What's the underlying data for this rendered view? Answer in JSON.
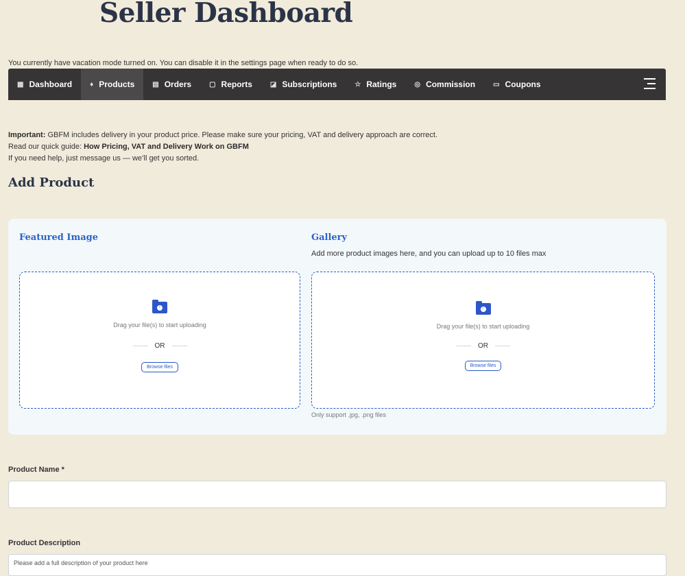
{
  "page_title": "Seller Dashboard",
  "vacation_notice": "You currently have vacation mode turned on. You can disable it in the settings page when ready to do so.",
  "nav": {
    "items": [
      {
        "label": "Dashboard",
        "icon": "grid-icon"
      },
      {
        "label": "Products",
        "icon": "shirt-icon",
        "active": true
      },
      {
        "label": "Orders",
        "icon": "cart-icon"
      },
      {
        "label": "Reports",
        "icon": "report-icon"
      },
      {
        "label": "Subscriptions",
        "icon": "tag-icon"
      },
      {
        "label": "Ratings",
        "icon": "star-icon"
      },
      {
        "label": "Commission",
        "icon": "coins-icon"
      },
      {
        "label": "Coupons",
        "icon": "coupon-icon"
      }
    ],
    "menu_icon": "hamburger-icon"
  },
  "notice": {
    "important_label": "Important:",
    "important_text": " GBFM includes delivery in your product price. Please make sure your pricing, VAT and delivery approach are correct.",
    "guide_prefix": "Read our quick guide: ",
    "guide_link": "How Pricing, VAT and Delivery Work on GBFM",
    "help_text": "If you need help, just message us — we’ll get you sorted."
  },
  "section_title": "Add Product",
  "featured_image": {
    "title": "Featured Image",
    "drag_text": "Drag your file(s) to start uploading",
    "or_text": "OR",
    "browse_label": "Browse files"
  },
  "gallery": {
    "title": "Gallery",
    "subtitle": "Add more product images here, and you can upload up to 10 files max",
    "drag_text": "Drag your file(s) to start uploading",
    "or_text": "OR",
    "browse_label": "Browse files",
    "support_text": "Only support .jpg, .png files"
  },
  "product_name": {
    "label": "Product Name *",
    "value": ""
  },
  "product_description": {
    "label": "Product Description",
    "placeholder": "Please add a full description of your product here"
  },
  "colors": {
    "background": "#f1ebdc",
    "nav": "#363434",
    "accent": "#2a56c6"
  }
}
